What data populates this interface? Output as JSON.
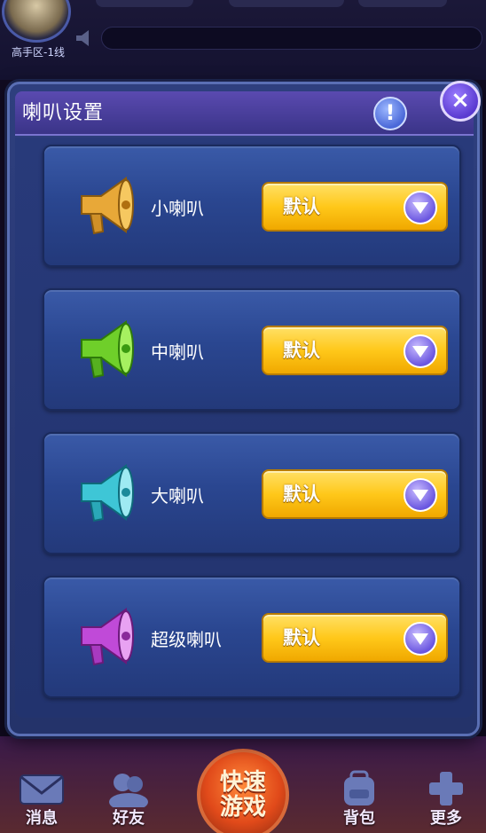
{
  "background": {
    "zone_label": "高手区-1线",
    "nav": [
      {
        "label": "消息",
        "icon": "envelope-icon"
      },
      {
        "label": "好友",
        "icon": "friends-icon"
      },
      {
        "label": "背包",
        "icon": "backpack-icon"
      },
      {
        "label": "更多",
        "icon": "plus-icon"
      }
    ],
    "quick_play": {
      "line1": "快速",
      "line2": "游戏"
    }
  },
  "dialog": {
    "title": "喇叭设置",
    "info_label": "!",
    "close_label": "×",
    "rows": [
      {
        "label": "小喇叭",
        "value": "默认",
        "icon": "gold-horn-icon",
        "color": "#e0a030"
      },
      {
        "label": "中喇叭",
        "value": "默认",
        "icon": "green-horn-icon",
        "color": "#6fcf2a"
      },
      {
        "label": "大喇叭",
        "value": "默认",
        "icon": "teal-horn-icon",
        "color": "#3ec6d6"
      },
      {
        "label": "超级喇叭",
        "value": "默认",
        "icon": "purple-horn-icon",
        "color": "#c04ad8"
      }
    ]
  },
  "colors": {
    "accent": "#ffc81a",
    "dialog_bg": "#2e3f7e",
    "header_bg": "#5a4ab0"
  }
}
